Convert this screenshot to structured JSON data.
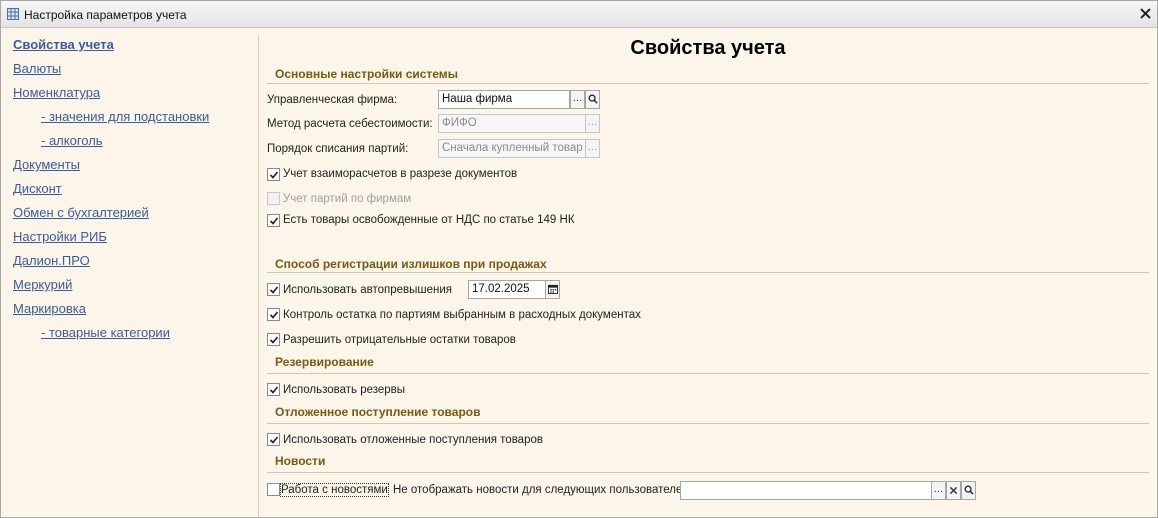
{
  "window": {
    "title": "Настройка параметров учета"
  },
  "sidebar": {
    "items": [
      {
        "label": "Свойства учета",
        "active": true
      },
      {
        "label": "Валюты"
      },
      {
        "label": "Номенклатура"
      },
      {
        "label": "- значения для подстановки",
        "sub": true
      },
      {
        "label": "- алкоголь",
        "sub": true
      },
      {
        "label": "Документы"
      },
      {
        "label": "Дисконт"
      },
      {
        "label": "Обмен с бухгалтерией"
      },
      {
        "label": "Настройки РИБ"
      },
      {
        "label": "Далион.ПРО"
      },
      {
        "label": "Меркурий"
      },
      {
        "label": "Маркировка"
      },
      {
        "label": "- товарные категории",
        "sub": true
      }
    ]
  },
  "main": {
    "title": "Свойства учета",
    "sections": {
      "basic": {
        "header": "Основные настройки системы",
        "firm_label": "Управленческая фирма:",
        "firm_value": "Наша фирма",
        "cost_label": "Метод расчета себестоимости:",
        "cost_value": "ФИФО",
        "writeoff_label": "Порядок списания партий:",
        "writeoff_value": "Сначала купленный товар",
        "cb_settlements": "Учет взаиморасчетов в разрезе документов",
        "cb_batches": "Учет партий по фирмам",
        "cb_vat": "Есть товары освобожденные от НДС по статье 149 НК"
      },
      "surplus": {
        "header": "Способ регистрации излишков при продажах",
        "cb_autoexceed": "Использовать автопревышения",
        "autoexceed_date": "17.02.2025",
        "cb_control": "Контроль остатка по партиям выбранным в расходных документах",
        "cb_negative": "Разрешить отрицательные остатки товаров"
      },
      "reserve": {
        "header": "Резервирование",
        "cb_use_reserve": "Использовать резервы"
      },
      "deferred": {
        "header": "Отложенное поступление товаров",
        "cb_deferred": "Использовать отложенные поступления товаров"
      },
      "news": {
        "header": "Новости",
        "cb_news": "Работа с новостями",
        "hide_label": "Не отображать новости для следующих пользователей:",
        "hide_value": ""
      }
    }
  },
  "colors": {
    "link": "#3a5aa8",
    "section_header": "#7a5a10",
    "background": "#fbf6e9"
  }
}
